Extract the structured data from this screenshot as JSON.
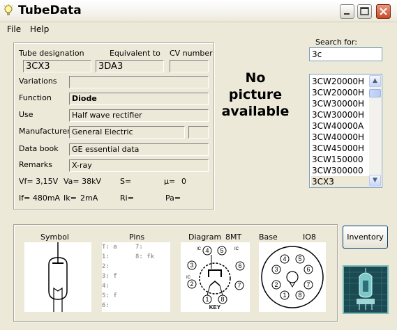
{
  "window": {
    "title": "TubeData",
    "icon": "bulb-icon"
  },
  "menu": [
    {
      "label": "File"
    },
    {
      "label": "Help"
    }
  ],
  "header": {
    "designation_label": "Tube designation",
    "equivalent_label": "Equivalent to",
    "cv_label": "CV number",
    "designation": "3CX3",
    "equivalent": "3DA3",
    "cv": ""
  },
  "fields": {
    "variations_label": "Variations",
    "variations": "",
    "function_label": "Function",
    "function": "Diode",
    "use_label": "Use",
    "use": "Half wave rectifier",
    "manufacturer_label": "Manufacturer",
    "manufacturer": "General Electric",
    "manufacturer_code": "",
    "databook_label": "Data book",
    "databook": "GE essential data",
    "remarks_label": "Remarks",
    "remarks": "X-ray"
  },
  "specs": {
    "vf": "Vf= 3,15V",
    "va": "Va= 38kV",
    "s": "S=",
    "mu": "µ=",
    "mu_val": "0",
    "if": "If= 480mA",
    "ik": "Ik=",
    "ik_val": "2mA",
    "ri": "Ri=",
    "pa": "Pa="
  },
  "picture": {
    "line1": "No",
    "line2": "picture",
    "line3": "available"
  },
  "search": {
    "label": "Search for:",
    "value": "3c"
  },
  "list": {
    "items": [
      "3CW20000H",
      "3CW20000H",
      "3CW30000H",
      "3CW30000H",
      "3CW40000A",
      "3CW40000H",
      "3CW45000H",
      "3CW150000",
      "3CW300000",
      "3CX3"
    ],
    "selected": "3CX3"
  },
  "bottom": {
    "symbol_label": "Symbol",
    "pins_label": "Pins",
    "diagram_label": "Diagram",
    "diagram_code": "8MT",
    "base_label": "Base",
    "base_code": "IO8",
    "pins": {
      "c1": [
        "T: a",
        "1:",
        "2:",
        "3: f",
        "4:",
        "5: f",
        "6:"
      ],
      "c2": [
        "7:",
        "8: fk"
      ]
    },
    "diagram_pin_labels": [
      "IC",
      "4",
      "5",
      "IC",
      "6",
      "IC",
      "2",
      "7",
      "1",
      "8",
      "KEY",
      "3"
    ],
    "base_pin_labels": [
      "4",
      "5",
      "3",
      "6",
      "2",
      "7",
      "1",
      "8"
    ]
  },
  "inventory_button": "Inventory",
  "colors": {
    "accent": "#7F9DB9",
    "close": "#C8492A",
    "face": "#ECE9D8"
  }
}
